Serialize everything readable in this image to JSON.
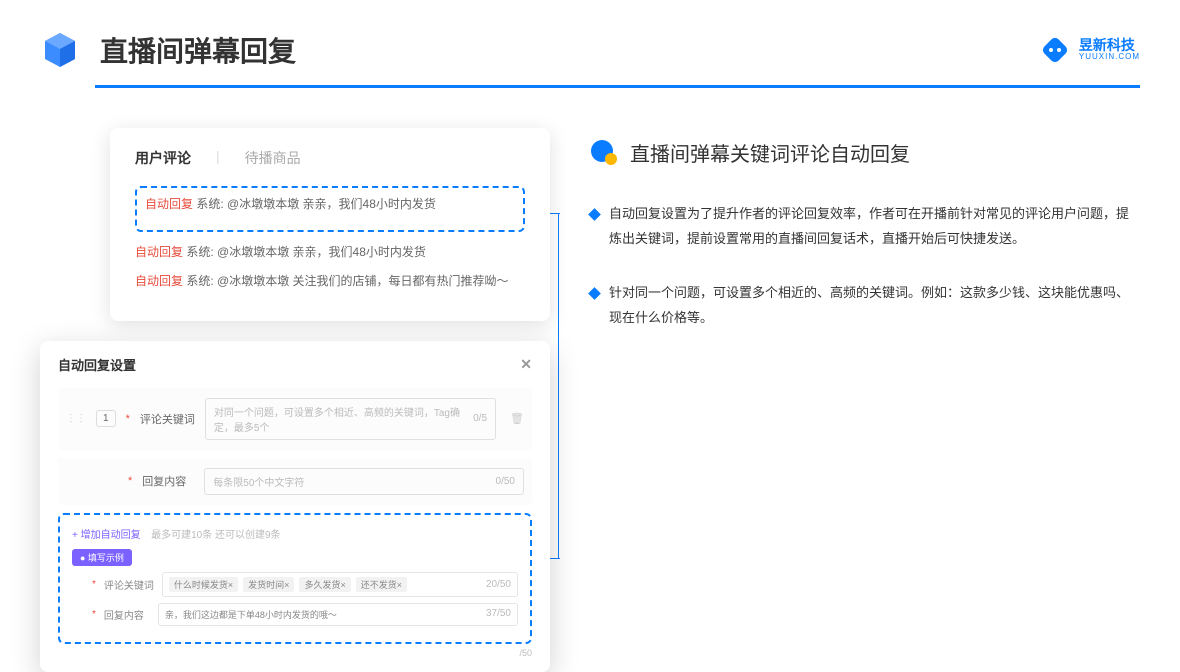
{
  "header": {
    "title": "直播间弹幕回复",
    "logo_cn": "昱新科技",
    "logo_en": "YUUXIN.COM"
  },
  "comments": {
    "tab_active": "用户评论",
    "tab_inactive": "待播商品",
    "rows": [
      {
        "badge": "自动回复",
        "text": "系统: @冰墩墩本墩 亲亲，我们48小时内发货"
      },
      {
        "badge": "自动回复",
        "text": "系统: @冰墩墩本墩 亲亲，我们48小时内发货"
      },
      {
        "badge": "自动回复",
        "text": "系统: @冰墩墩本墩 关注我们的店铺，每日都有热门推荐呦～"
      }
    ]
  },
  "settings": {
    "title": "自动回复设置",
    "idx": "1",
    "field1_label": "评论关键词",
    "field1_ph": "对同一个问题，可设置多个相近、高频的关键词，Tag确定，最多5个",
    "field1_count": "0/5",
    "field2_label": "回复内容",
    "field2_ph": "每条限50个中文字符",
    "field2_count": "0/50",
    "add_text": "+ 增加自动回复",
    "add_hint": "最多可建10条 还可以创建9条",
    "example_badge": "● 填写示例",
    "ex_kw_label": "评论关键词",
    "ex_tags": [
      "什么时候发货×",
      "发货时间×",
      "多久发货×",
      "还不发货×"
    ],
    "ex_kw_count": "20/50",
    "ex_reply_label": "回复内容",
    "ex_reply_text": "亲，我们这边都是下单48小时内发货的哦～",
    "ex_reply_count": "37/50",
    "bottom_count": "/50"
  },
  "right": {
    "subtitle": "直播间弹幕关键词评论自动回复",
    "bullet1": "自动回复设置为了提升作者的评论回复效率，作者可在开播前针对常见的评论用户问题，提炼出关键词，提前设置常用的直播间回复话术，直播开始后可快捷发送。",
    "bullet2": "针对同一个问题，可设置多个相近的、高频的关键词。例如：这款多少钱、这块能优惠吗、现在什么价格等。"
  }
}
